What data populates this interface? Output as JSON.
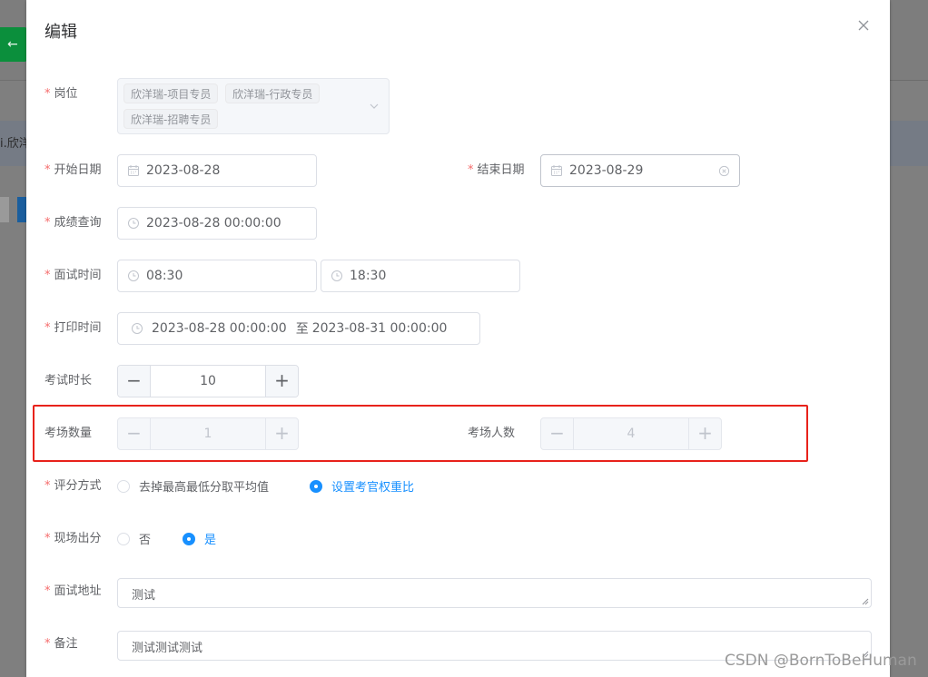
{
  "background": {
    "back_button_label": "← ",
    "info_text": "i.欣洋"
  },
  "dialog": {
    "title": "编辑",
    "close_icon": "close-icon"
  },
  "form": {
    "required_mark": "*",
    "position": {
      "label": "岗位",
      "tags": [
        "欣洋瑞-项目专员",
        "欣洋瑞-行政专员",
        "欣洋瑞-招聘专员"
      ]
    },
    "start_date": {
      "label": "开始日期",
      "value": "2023-08-28"
    },
    "end_date": {
      "label": "结束日期",
      "value": "2023-08-29"
    },
    "score_query": {
      "label": "成绩查询",
      "value": "2023-08-28 00:00:00"
    },
    "interview_time": {
      "label": "面试时间",
      "start": "08:30",
      "end": "18:30"
    },
    "print_time": {
      "label": "打印时间",
      "start": "2023-08-28 00:00:00",
      "separator": "至",
      "end": "2023-08-31 00:00:00"
    },
    "exam_duration": {
      "label": "考试时长",
      "value": "10",
      "minus": "−",
      "plus": "+"
    },
    "exam_room_count": {
      "label": "考场数量",
      "value": "1",
      "minus": "−",
      "plus": "+"
    },
    "exam_room_people": {
      "label": "考场人数",
      "value": "4",
      "minus": "−",
      "plus": "+"
    },
    "scoring_method": {
      "label": "评分方式",
      "options": [
        "去掉最高最低分取平均值",
        "设置考官权重比"
      ],
      "selected": "设置考官权重比"
    },
    "onsite_score": {
      "label": "现场出分",
      "options": [
        "否",
        "是"
      ],
      "selected": "是"
    },
    "interview_address": {
      "label": "面试地址",
      "value": "测试"
    },
    "remark": {
      "label": "备注",
      "value": "测试测试测试"
    }
  },
  "watermark": "CSDN @BornToBeHuman",
  "colors": {
    "primary": "#1890ff",
    "required": "#f56c6c",
    "highlight_border": "#e8221b"
  }
}
